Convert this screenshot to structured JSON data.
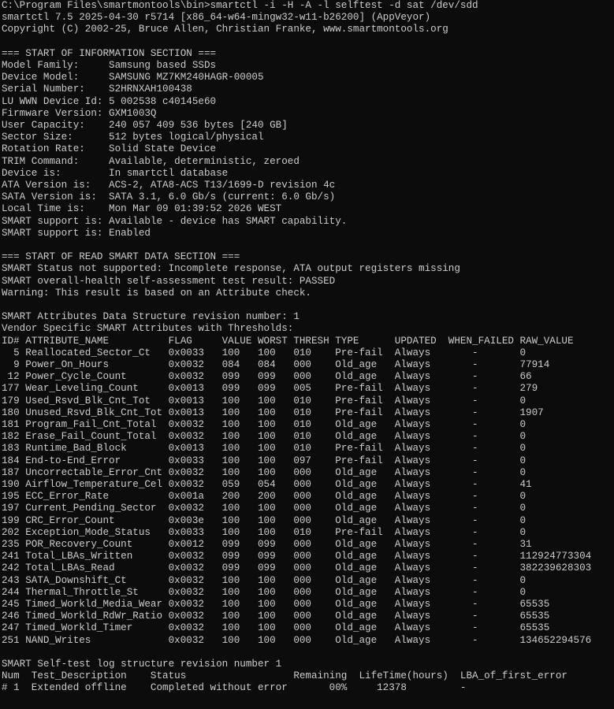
{
  "terminal": {
    "background": "#0c0c0c",
    "foreground": "#cccccc",
    "lines": [
      "C:\\Program Files\\smartmontools\\bin>smartctl -i -H -A -l selftest -d sat /dev/sdd",
      "smartctl 7.5 2025-04-30 r5714 [x86_64-w64-mingw32-w11-b26200] (AppVeyor)",
      "Copyright (C) 2002-25, Bruce Allen, Christian Franke, www.smartmontools.org",
      "",
      "=== START OF INFORMATION SECTION ===",
      "Model Family:     Samsung based SSDs",
      "Device Model:     SAMSUNG MZ7KM240HAGR-00005",
      "Serial Number:    S2HRNXAH100438",
      "LU WWN Device Id: 5 002538 c40145e60",
      "Firmware Version: GXM1003Q",
      "User Capacity:    240 057 409 536 bytes [240 GB]",
      "Sector Size:      512 bytes logical/physical",
      "Rotation Rate:    Solid State Device",
      "TRIM Command:     Available, deterministic, zeroed",
      "Device is:        In smartctl database",
      "ATA Version is:   ACS-2, ATA8-ACS T13/1699-D revision 4c",
      "SATA Version is:  SATA 3.1, 6.0 Gb/s (current: 6.0 Gb/s)",
      "Local Time is:    Mon Mar 09 01:39:52 2026 WEST",
      "SMART support is: Available - device has SMART capability.",
      "SMART support is: Enabled",
      "",
      "=== START OF READ SMART DATA SECTION ===",
      "SMART Status not supported: Incomplete response, ATA output registers missing",
      "SMART overall-health self-assessment test result: PASSED",
      "Warning: This result is based on an Attribute check.",
      "",
      "SMART Attributes Data Structure revision number: 1",
      "Vendor Specific SMART Attributes with Thresholds:",
      "ID# ATTRIBUTE_NAME          FLAG     VALUE WORST THRESH TYPE      UPDATED  WHEN_FAILED RAW_VALUE",
      "  5 Reallocated_Sector_Ct   0x0033   100   100   010    Pre-fail  Always       -       0",
      "  9 Power_On_Hours          0x0032   084   084   000    Old_age   Always       -       77914",
      " 12 Power_Cycle_Count       0x0032   099   099   000    Old_age   Always       -       66",
      "177 Wear_Leveling_Count     0x0013   099   099   005    Pre-fail  Always       -       279",
      "179 Used_Rsvd_Blk_Cnt_Tot   0x0013   100   100   010    Pre-fail  Always       -       0",
      "180 Unused_Rsvd_Blk_Cnt_Tot 0x0013   100   100   010    Pre-fail  Always       -       1907",
      "181 Program_Fail_Cnt_Total  0x0032   100   100   010    Old_age   Always       -       0",
      "182 Erase_Fail_Count_Total  0x0032   100   100   010    Old_age   Always       -       0",
      "183 Runtime_Bad_Block       0x0013   100   100   010    Pre-fail  Always       -       0",
      "184 End-to-End_Error        0x0033   100   100   097    Pre-fail  Always       -       0",
      "187 Uncorrectable_Error_Cnt 0x0032   100   100   000    Old_age   Always       -       0",
      "190 Airflow_Temperature_Cel 0x0032   059   054   000    Old_age   Always       -       41",
      "195 ECC_Error_Rate          0x001a   200   200   000    Old_age   Always       -       0",
      "197 Current_Pending_Sector  0x0032   100   100   000    Old_age   Always       -       0",
      "199 CRC_Error_Count         0x003e   100   100   000    Old_age   Always       -       0",
      "202 Exception_Mode_Status   0x0033   100   100   010    Pre-fail  Always       -       0",
      "235 POR_Recovery_Count      0x0012   099   099   000    Old_age   Always       -       31",
      "241 Total_LBAs_Written      0x0032   099   099   000    Old_age   Always       -       112924773304",
      "242 Total_LBAs_Read         0x0032   099   099   000    Old_age   Always       -       382239628303",
      "243 SATA_Downshift_Ct       0x0032   100   100   000    Old_age   Always       -       0",
      "244 Thermal_Throttle_St     0x0032   100   100   000    Old_age   Always       -       0",
      "245 Timed_Workld_Media_Wear 0x0032   100   100   000    Old_age   Always       -       65535",
      "246 Timed_Workld_RdWr_Ratio 0x0032   100   100   000    Old_age   Always       -       65535",
      "247 Timed_Workld_Timer      0x0032   100   100   000    Old_age   Always       -       65535",
      "251 NAND_Writes             0x0032   100   100   000    Old_age   Always       -       134652294576",
      "",
      "SMART Self-test log structure revision number 1",
      "Num  Test_Description    Status                  Remaining  LifeTime(hours)  LBA_of_first_error",
      "# 1  Extended offline    Completed without error       00%     12378         -"
    ]
  }
}
